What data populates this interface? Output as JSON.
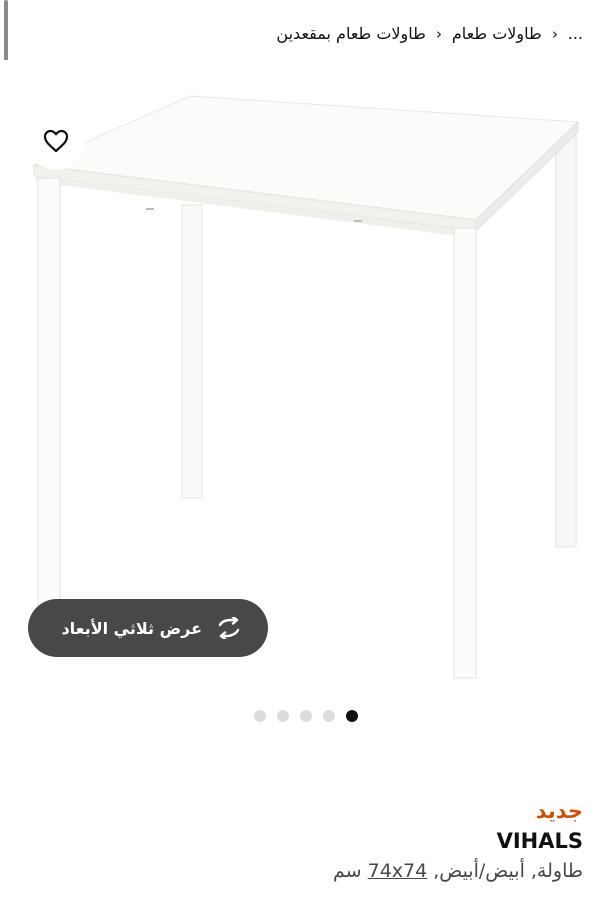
{
  "breadcrumb": {
    "ellipsis": "...",
    "items": [
      "طاولات طعام",
      "طاولات طعام بمقعدين"
    ]
  },
  "product_image": {
    "alt_subject": "table-photo",
    "carousel": {
      "total": 5,
      "active_index": 0
    }
  },
  "view3d": {
    "label": "عرض ثلاثي الأبعاد"
  },
  "product": {
    "badge": "جديد",
    "name": "VIHALS",
    "description_prefix": "طاولة, أبيض/أبيض, ",
    "size": "74x74",
    "unit": " سم"
  },
  "colors": {
    "badge": "#ca5008",
    "pill_bg": "#484848",
    "dot_active": "#111111",
    "dot_inactive": "#dcdcdc"
  }
}
